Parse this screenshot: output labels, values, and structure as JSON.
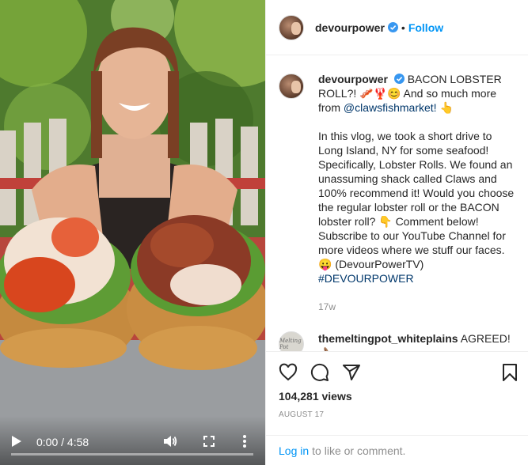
{
  "post": {
    "username": "devourpower",
    "follow_label": "Follow",
    "dot": "•"
  },
  "caption": {
    "username": "devourpower",
    "line1": "BACON LOBSTER ROLL?! 🥓🦞😊 And so much more from ",
    "mention": "@clawsfishmarket!",
    "line1_end": " 👆",
    "paragraph2": "In this vlog, we took a short drive to Long Island, NY for some seafood! Specifically, Lobster Rolls. We found an unassuming shack called Claws and 100% recommend it! Would you choose the regular lobster roll or the BACON lobster roll? 👇 Comment below! Subscribe to our YouTube Channel for more videos where we stuff our faces. 😛 (DevourPowerTV)",
    "hashtag": "#DEVOURPOWER",
    "age": "17w"
  },
  "comment": {
    "username": "themeltingpot_whiteplains",
    "text": "AGREED!",
    "emoji": "👌🏽",
    "avatar_text": "Melting Pot"
  },
  "video": {
    "time": "0:00 / 4:58",
    "progress": 0.0
  },
  "stats": {
    "views": "104,281 views",
    "date": "AUGUST 17"
  },
  "login": {
    "link": "Log in",
    "text": "to like or comment."
  },
  "colors": {
    "accent": "#0095f6",
    "verified": "#3897f0"
  }
}
